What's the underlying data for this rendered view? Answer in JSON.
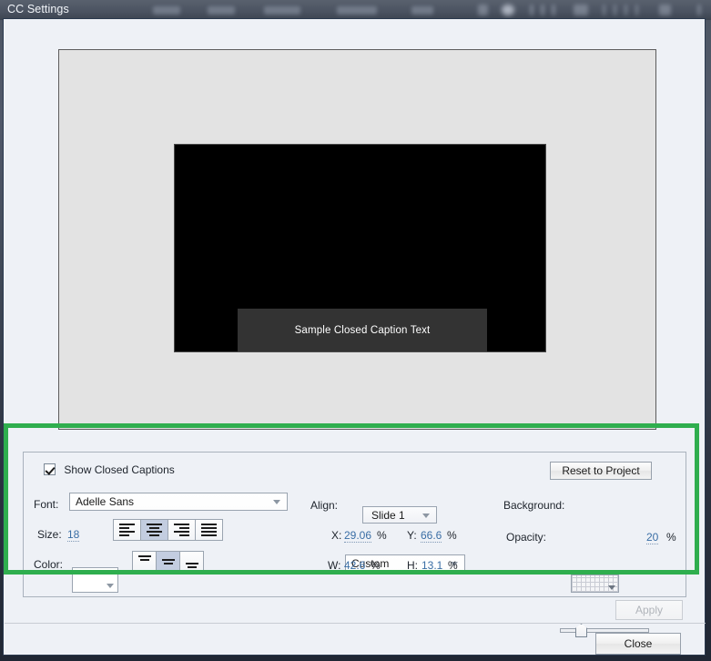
{
  "window": {
    "title": "CC Settings"
  },
  "preview": {
    "caption_text": "Sample Closed Caption Text"
  },
  "settings": {
    "show_captions_label": "Show Closed Captions",
    "show_captions_checked": true,
    "font_label": "Font:",
    "font_value": "Adelle Sans",
    "size_label": "Size:",
    "size_value": "18",
    "color_label": "Color:",
    "color_value": "#ffffff",
    "align_buttons": [
      {
        "name": "align-left",
        "selected": false
      },
      {
        "name": "align-center",
        "selected": true
      },
      {
        "name": "align-right",
        "selected": false
      },
      {
        "name": "align-justify",
        "selected": false
      }
    ],
    "valign_buttons": [
      {
        "name": "valign-top",
        "selected": false
      },
      {
        "name": "valign-middle",
        "selected": true
      },
      {
        "name": "valign-bottom",
        "selected": false
      }
    ]
  },
  "placement": {
    "slide_value": "Slide 1",
    "align_label": "Align:",
    "align_value": "Custom",
    "x_label": "X:",
    "x_value": "29.06",
    "x_unit": "%",
    "y_label": "Y:",
    "y_value": "66.6",
    "y_unit": "%",
    "w_label": "W:",
    "w_value": "42.6",
    "w_unit": "%",
    "h_label": "H:",
    "h_value": "13.1",
    "h_unit": "%"
  },
  "appearance": {
    "reset_label": "Reset to Project",
    "background_label": "Background:",
    "opacity_label": "Opacity:",
    "opacity_value": "20",
    "opacity_unit": "%"
  },
  "footer": {
    "apply_label": "Apply",
    "apply_enabled": false,
    "close_label": "Close"
  },
  "colors": {
    "highlight": "#2fae4e",
    "accent_link": "#3a6ea5",
    "dialog_bg": "#eef1f6",
    "stage_bg": "#e3e3e3",
    "video_bg": "#000000",
    "caption_bg": "#333333"
  }
}
